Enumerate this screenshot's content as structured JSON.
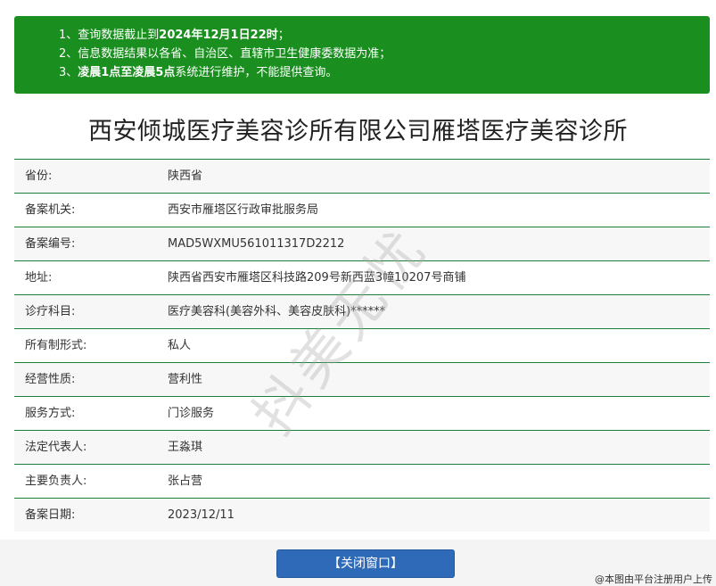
{
  "notice": {
    "line1_prefix": "1、查询数据截止到",
    "line1_bold": "2024年12月1日22时",
    "line1_suffix": "；",
    "line2": "2、信息数据结果以各省、自治区、直辖市卫生健康委数据为准；",
    "line3_prefix": "3、",
    "line3_bold": "凌晨1点至凌晨5点",
    "line3_suffix": "系统进行维护，不能提供查询。"
  },
  "title": "西安倾城医疗美容诊所有限公司雁塔医疗美容诊所",
  "rows": [
    {
      "label": "省份:",
      "value": "陕西省"
    },
    {
      "label": "备案机关:",
      "value": "西安市雁塔区行政审批服务局"
    },
    {
      "label": "备案编号:",
      "value": "MAD5WXMU561011317D2212"
    },
    {
      "label": "地址:",
      "value": "陕西省西安市雁塔区科技路209号新西蓝3幢10207号商铺"
    },
    {
      "label": "诊疗科目:",
      "value": "医疗美容科(美容外科、美容皮肤科)******"
    },
    {
      "label": "所有制形式:",
      "value": "私人"
    },
    {
      "label": "经营性质:",
      "value": "营利性"
    },
    {
      "label": "服务方式:",
      "value": "门诊服务"
    },
    {
      "label": "法定代表人:",
      "value": "王淼琪"
    },
    {
      "label": "主要负责人:",
      "value": "张占营"
    },
    {
      "label": "备案日期:",
      "value": "2023/12/11"
    }
  ],
  "watermark": "抖美无忧",
  "close_button": "【关闭窗口】",
  "credit": "@本图由平台注册用户上传"
}
